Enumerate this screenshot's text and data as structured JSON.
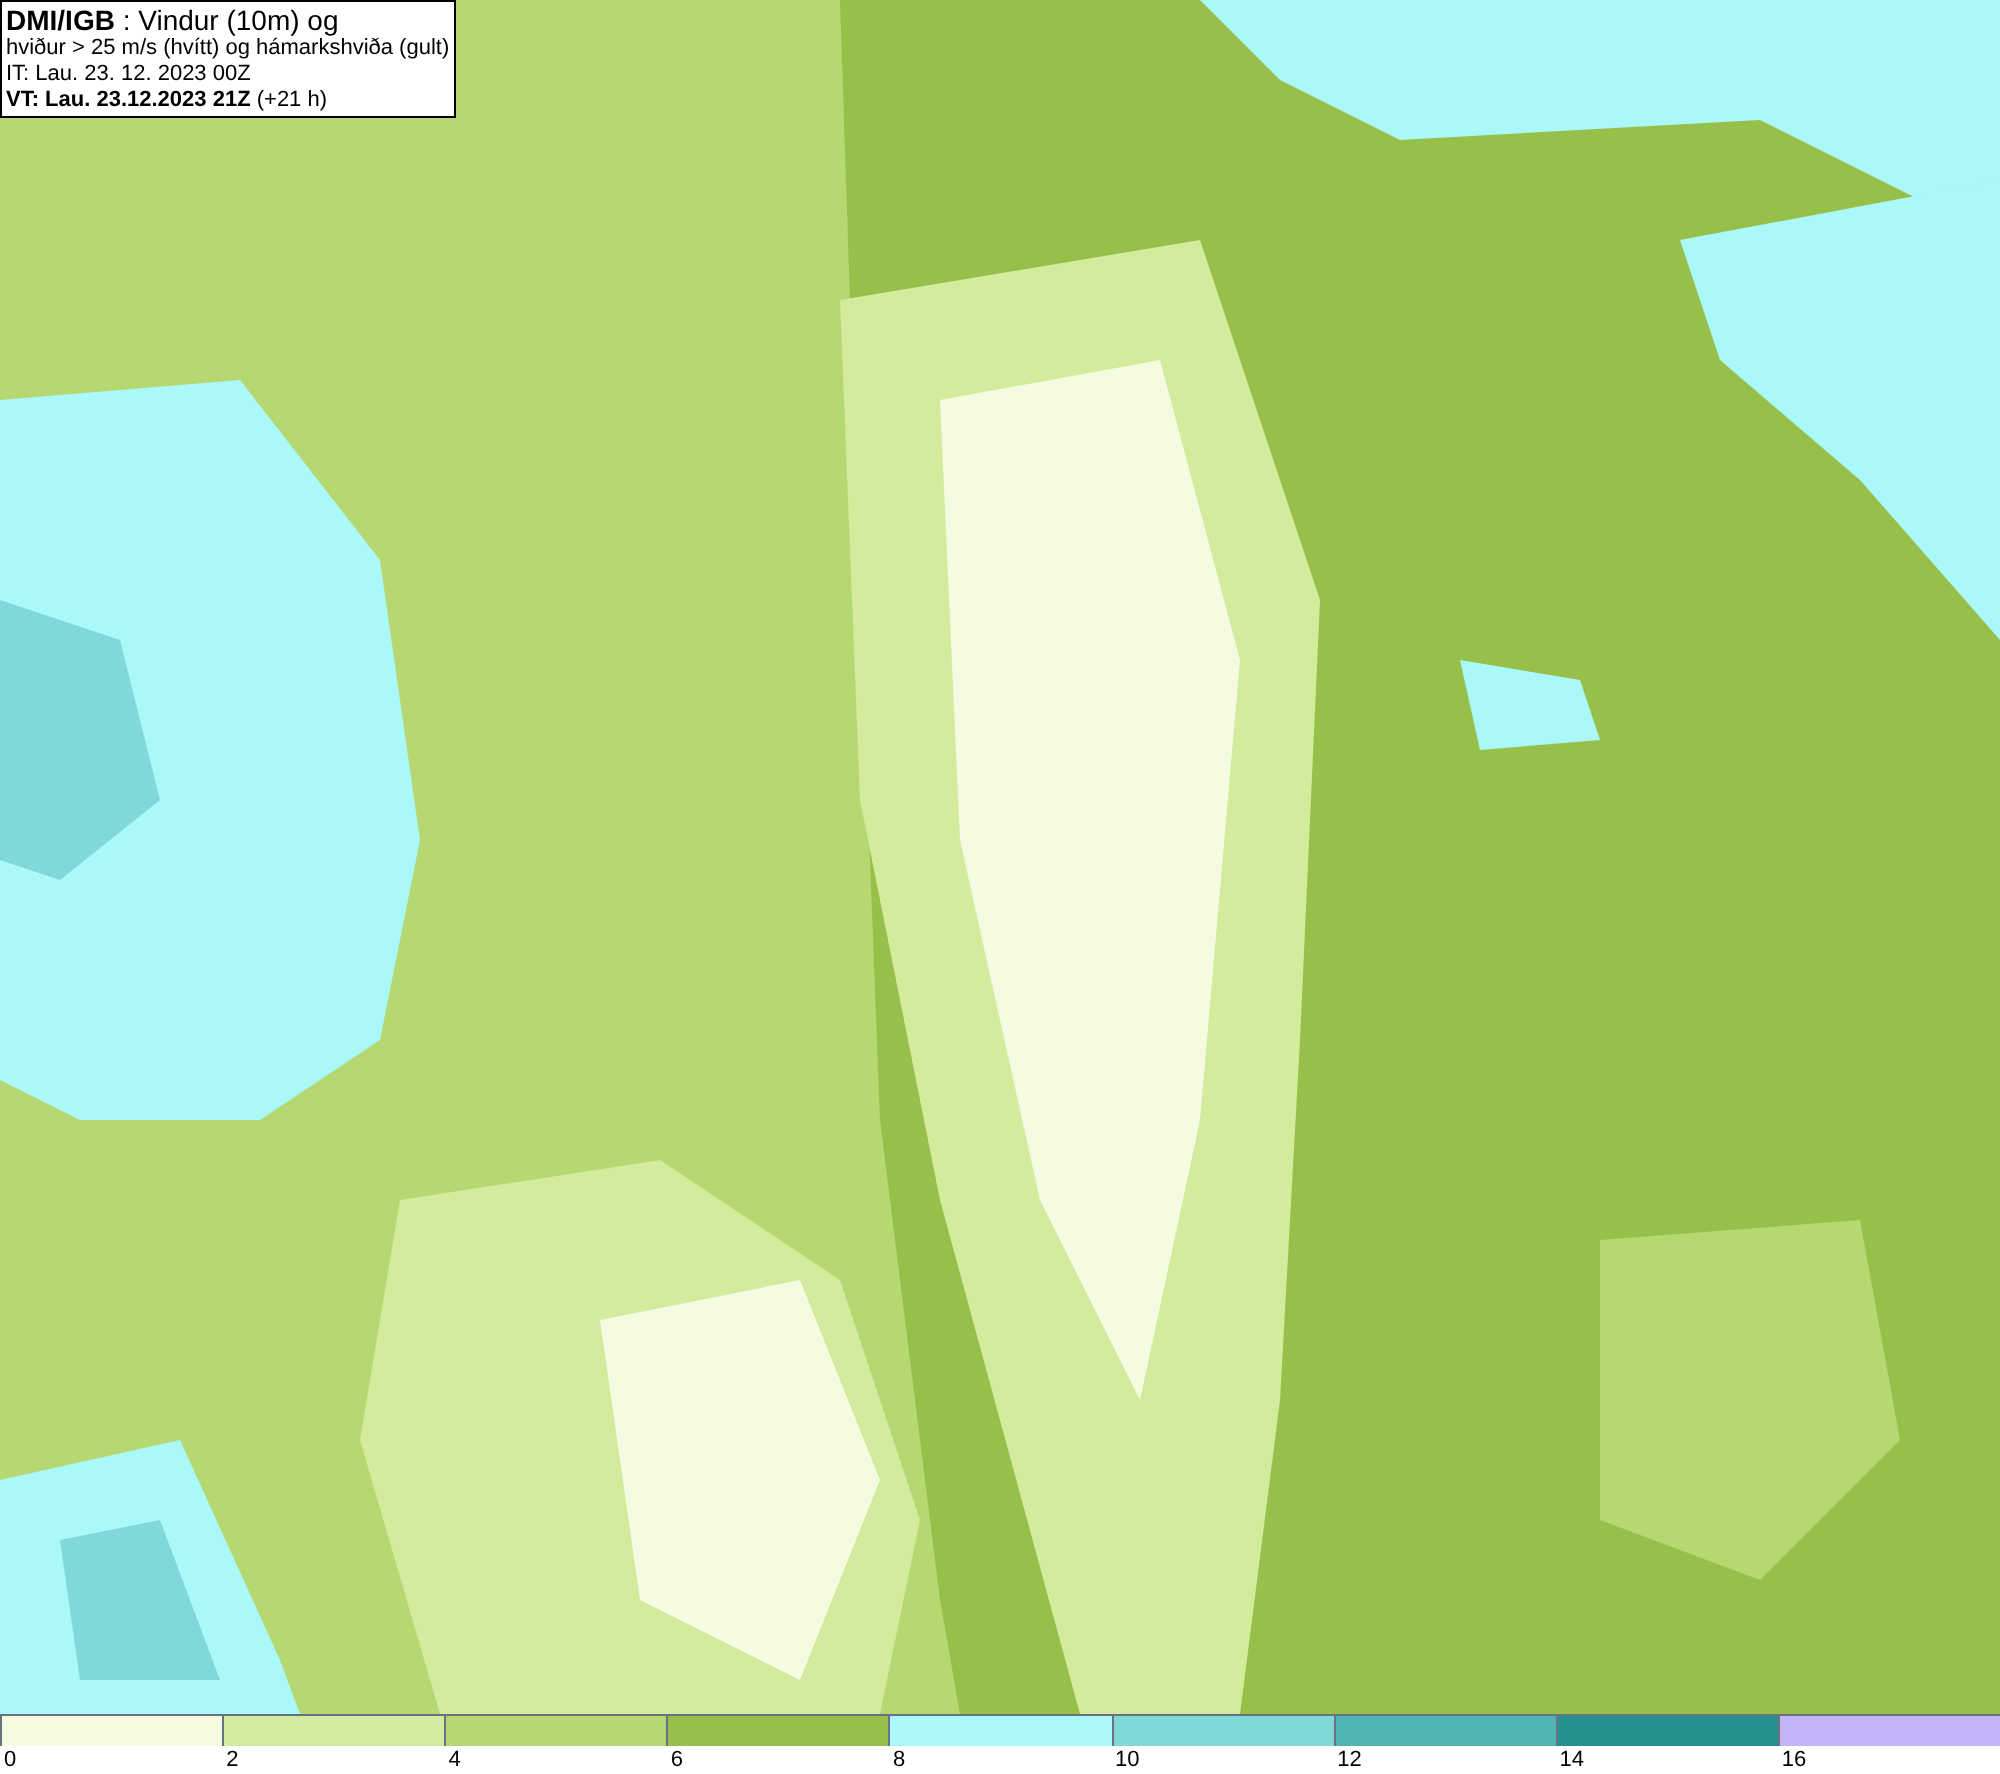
{
  "header": {
    "lines": [
      "**DMI/IGB** : Vindur (10m) og",
      "hviður > 25 m/s (hvítt) og hámarkshviða (gult)",
      "IT: Lau. 23. 12. 2023 00Z",
      "**VT: Lau. 23.12.2023 21Z** (+21 h)"
    ]
  },
  "legend": [
    {
      "label": "0",
      "color": "#f4fbe0"
    },
    {
      "label": "2",
      "color": "#d2eb9c"
    },
    {
      "label": "4",
      "color": "#b5d872"
    },
    {
      "label": "6",
      "color": "#97c04a"
    },
    {
      "label": "8",
      "color": "#aaf8f8"
    },
    {
      "label": "10",
      "color": "#80d8d8"
    },
    {
      "label": "12",
      "color": "#50b4b4"
    },
    {
      "label": "14",
      "color": "#249090"
    },
    {
      "label": "16",
      "color": "#c2b4f6"
    }
  ]
}
